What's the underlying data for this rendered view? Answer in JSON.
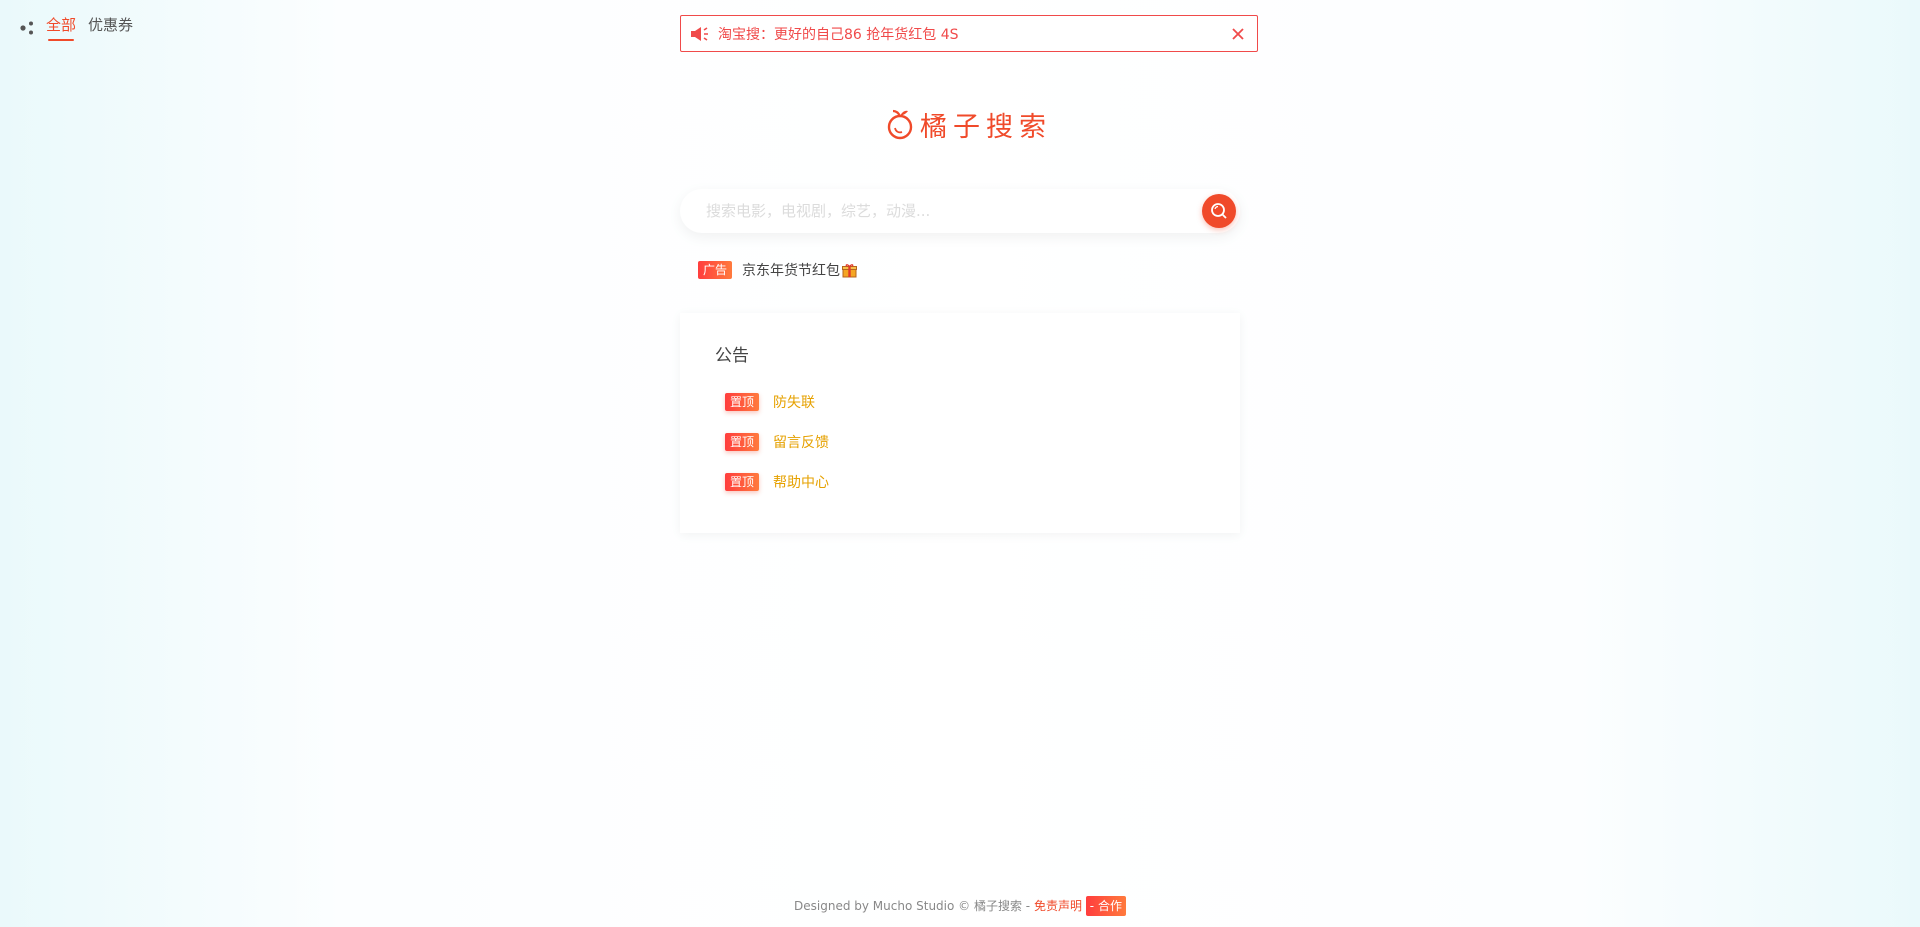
{
  "nav": {
    "tabs": [
      {
        "label": "全部",
        "active": true
      },
      {
        "label": "优惠券",
        "active": false
      }
    ]
  },
  "banner": {
    "text": "淘宝搜：更好的自己86 抢年货红包 4S"
  },
  "logo": {
    "name": "橘子搜索"
  },
  "search": {
    "placeholder": "搜索电影，电视剧，综艺，动漫..."
  },
  "ad": {
    "badge": "广告",
    "text": "京东年货节红包"
  },
  "notice": {
    "title": "公告",
    "items": [
      {
        "badge": "置顶",
        "label": "防失联"
      },
      {
        "badge": "置顶",
        "label": "留言反馈"
      },
      {
        "badge": "置顶",
        "label": "帮助中心"
      }
    ]
  },
  "footer": {
    "credit": "Designed by Mucho Studio © 橘子搜索 - ",
    "disclaimer": "免责声明",
    "cooperation": "- 合作"
  },
  "colors": {
    "accent": "#f04a2a",
    "link": "#e6a100"
  }
}
